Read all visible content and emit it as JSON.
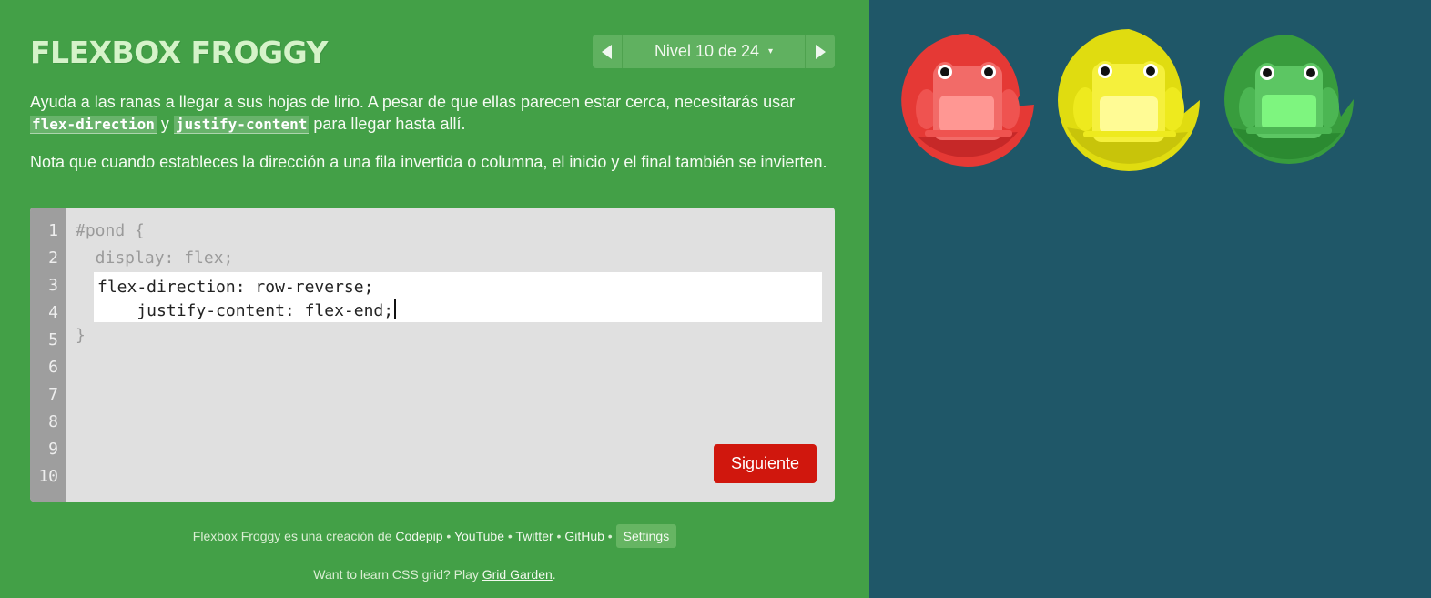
{
  "header": {
    "logo": "FLEXBOX FROGGY",
    "level_label": "Nivel 10 de 24",
    "level_caret": "▾"
  },
  "instructions": {
    "p1_before": "Ayuda a las ranas a llegar a sus hojas de lirio. A pesar de que ellas parecen estar cerca, necesitarás usar ",
    "kw1": "flex-direction",
    "p1_mid": " y ",
    "kw2": "justify-content",
    "p1_after": " para llegar hasta allí.",
    "p2": "Nota que cuando estableces la dirección a una fila invertida o columna, el inicio y el final también se invierten."
  },
  "editor": {
    "line_numbers": [
      "1",
      "2",
      "3",
      "4",
      "5",
      "6",
      "7",
      "8",
      "9",
      "10"
    ],
    "line1": "#pond {",
    "line2": "  display: flex;",
    "input_line1": "flex-direction: row-reverse;",
    "input_line2": "    justify-content: flex-end;",
    "line_close": "}",
    "next_label": "Siguiente"
  },
  "footer": {
    "credit_text": "Flexbox Froggy es una creación de ",
    "links": [
      "Codepip",
      "YouTube",
      "Twitter",
      "GitHub"
    ],
    "sep": " • ",
    "settings_label": "Settings",
    "promo_text": "Want to learn CSS grid? Play ",
    "promo_link": "Grid Garden",
    "promo_end": "."
  },
  "colors": {
    "sidebar": "#43a047",
    "pond": "#1f5768",
    "red_frog": "#ef5350",
    "yellow_frog": "#ffeb3b",
    "green_frog": "#66bb6a",
    "next_button": "#d0170d"
  },
  "pond": {
    "lilypads": [
      {
        "color": "red",
        "pad": "#e53935",
        "frog": "#ef6a67"
      },
      {
        "color": "yellow",
        "pad": "#e3e00f",
        "frog": "#f5f142"
      },
      {
        "color": "green",
        "pad": "#389c3d",
        "frog": "#5bc461"
      }
    ]
  }
}
